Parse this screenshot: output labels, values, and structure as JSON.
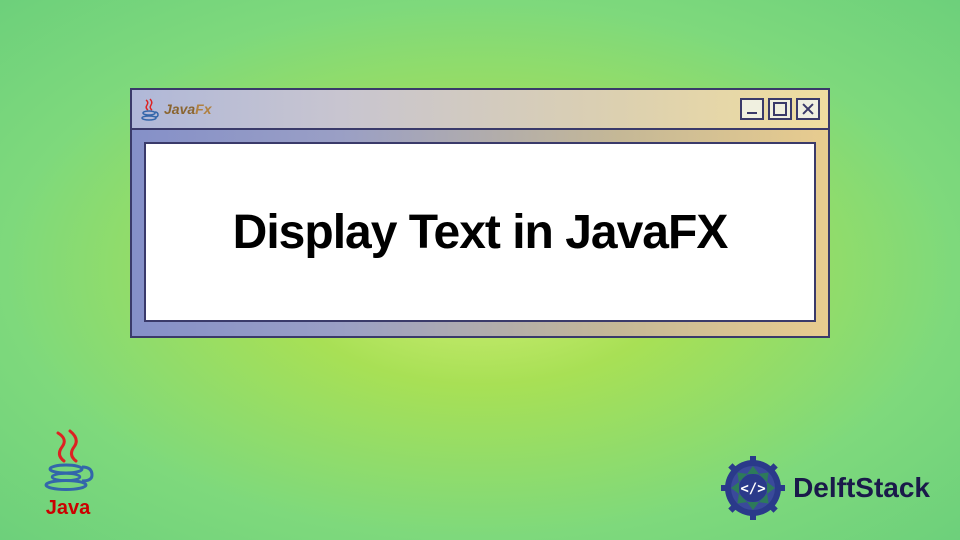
{
  "window": {
    "title_app": "Java",
    "title_suffix": "Fx",
    "content_text": "Display Text in JavaFX"
  },
  "logos": {
    "java_label": "Java",
    "delftstack_label": "DelftStack"
  },
  "window_controls": {
    "minimize": "minimize",
    "maximize": "maximize",
    "close": "close"
  }
}
